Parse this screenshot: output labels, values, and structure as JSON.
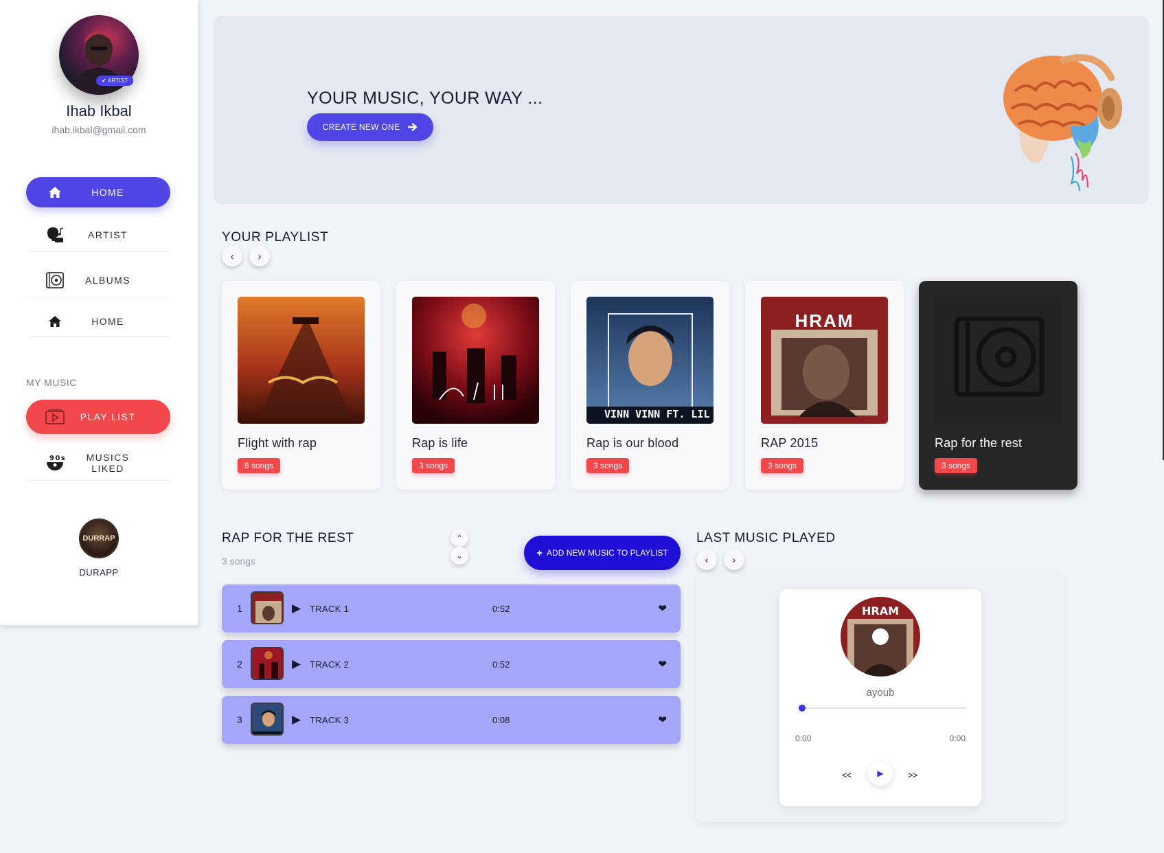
{
  "profile": {
    "name": "Ihab Ikbal",
    "email": "ihab.ikbal@gmail.com",
    "badge": "✔ ARTIST"
  },
  "nav": {
    "items": [
      {
        "label": "HOME",
        "icon": "home-icon",
        "active": true
      },
      {
        "label": "ARTIST",
        "icon": "artist-icon"
      },
      {
        "label": "ALBUMS",
        "icon": "album-icon"
      },
      {
        "label": "HOME",
        "icon": "home-icon"
      }
    ],
    "section_label": "MY MUSIC",
    "music_items": [
      {
        "label": "PLAY LIST",
        "icon": "playlist-icon",
        "active": true
      },
      {
        "label": "MUSICS LIKED",
        "icon": "vinyl-90s-icon"
      }
    ]
  },
  "brand": {
    "logo_text": "DURRAP",
    "label": "DURAPP"
  },
  "banner": {
    "title": "YOUR MUSIC, YOUR WAY ...",
    "button_label": "CREATE NEW ONE",
    "button_icon": "arrow-right-icon",
    "illustration": "brain-headphones-icon"
  },
  "playlist": {
    "title": "YOUR PLAYLIST",
    "cards": [
      {
        "title": "Flight with rap",
        "songs": "8 songs",
        "cover_color": "#b24116"
      },
      {
        "title": "Rap is life",
        "songs": "3 songs",
        "cover_color": "#9d1424"
      },
      {
        "title": "Rap is our blood",
        "songs": "3 songs",
        "cover_color": "#2b4a78",
        "cover_caption": "VINN VINN FT. LIL EYTCH"
      },
      {
        "title": "RAP 2015",
        "songs": "3 songs",
        "cover_color": "#8c1f1f",
        "cover_caption": "HRAM"
      },
      {
        "title": "Rap for the rest",
        "songs": "3 songs",
        "cover_color": "#262626",
        "selected": true
      }
    ]
  },
  "tracklist": {
    "title": "RAP FOR THE REST",
    "count": "3 songs",
    "add_button": "ADD NEW MUSIC TO PLAYLIST",
    "tracks": [
      {
        "num": "1",
        "name": "TRACK 1",
        "duration": "0:52"
      },
      {
        "num": "2",
        "name": "TRACK 2",
        "duration": "0:52"
      },
      {
        "num": "3",
        "name": "TRACK 3",
        "duration": "0:08"
      }
    ]
  },
  "last_played": {
    "title": "LAST MUSIC PLAYED",
    "artist": "ayoub",
    "time_current": "0:00",
    "time_total": "0:00",
    "progress": 0,
    "controls": {
      "prev": "<<",
      "play": "▶",
      "next": ">>"
    }
  },
  "colors": {
    "accent": "#4f46e5",
    "danger": "#f2484c",
    "track_row": "#a3a6fa",
    "add_button": "#1e0fd6",
    "background": "#f0f3f7"
  }
}
